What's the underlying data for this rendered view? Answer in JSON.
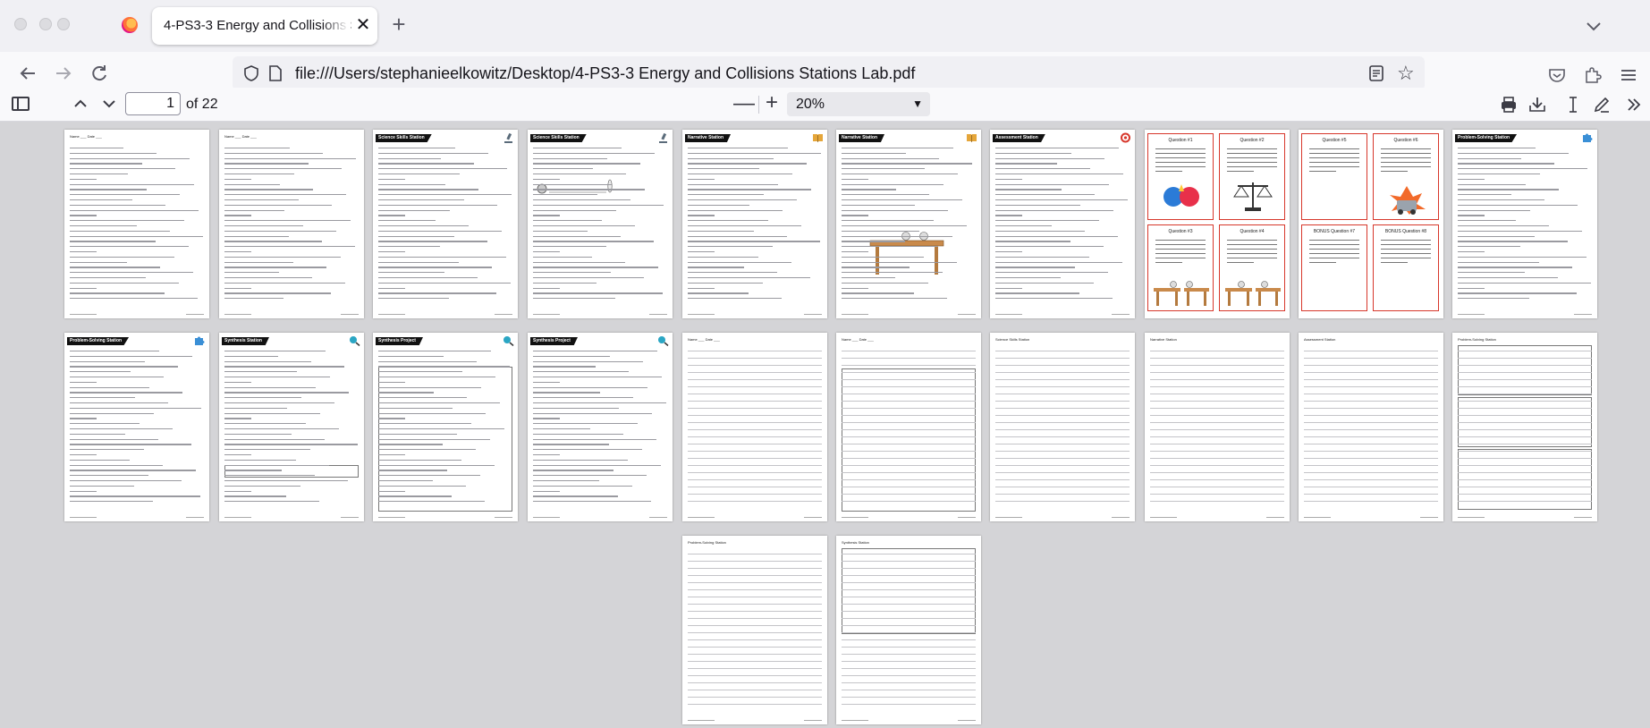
{
  "browser": {
    "tab_title": "4-PS3-3 Energy and Collisions Stations Lab.pdf",
    "tab_close_glyph": "✕",
    "new_tab_glyph": "+",
    "url": "file:///Users/stephanieelkowitz/Desktop/4-PS3-3 Energy and Collisions Stations Lab.pdf",
    "icons": [
      "firefox-logo",
      "back-arrow-icon",
      "forward-arrow-icon",
      "reload-icon",
      "shield-icon",
      "page-icon",
      "reader-view-icon",
      "bookmark-star-icon",
      "pocket-icon",
      "extensions-icon",
      "menu-icon",
      "tab-list-icon"
    ]
  },
  "pdf_toolbar": {
    "page_input": "1",
    "page_count": "of 22",
    "zoom_value": "20%",
    "zoom_out_glyph": "—",
    "zoom_in_glyph": "+",
    "icons": [
      "sidebar-toggle-icon",
      "page-up-icon",
      "page-down-icon",
      "print-icon",
      "download-icon",
      "text-cursor-icon",
      "draw-icon",
      "more-tools-icon"
    ]
  },
  "pages": [
    {
      "n": 1,
      "header": "Name ___ Date ___",
      "kind": "plain"
    },
    {
      "n": 2,
      "header": "Name ___ Date ___",
      "kind": "plain"
    },
    {
      "n": 3,
      "header": "Science Skills Station",
      "kind": "banner"
    },
    {
      "n": 4,
      "header": "Science Skills Station",
      "kind": "banner"
    },
    {
      "n": 5,
      "header": "Narrative Station",
      "kind": "banner"
    },
    {
      "n": 6,
      "header": "Narrative Station",
      "kind": "banner"
    },
    {
      "n": 7,
      "header": "Assessment Station",
      "kind": "banner"
    },
    {
      "n": 8,
      "header": "",
      "kind": "cards"
    },
    {
      "n": 9,
      "header": "",
      "kind": "cards"
    },
    {
      "n": 10,
      "header": "Problem-Solving Station",
      "kind": "banner"
    },
    {
      "n": 11,
      "header": "Problem-Solving Station",
      "kind": "banner"
    },
    {
      "n": 12,
      "header": "Synthesis Station",
      "kind": "banner"
    },
    {
      "n": 13,
      "header": "Synthesis Project",
      "kind": "banner"
    },
    {
      "n": 14,
      "header": "Synthesis Project",
      "kind": "banner"
    },
    {
      "n": 15,
      "header": "Name ___ Date ___",
      "kind": "plain"
    },
    {
      "n": 16,
      "header": "Name ___ Date ___",
      "kind": "plain"
    },
    {
      "n": 17,
      "header": "Science Skills Station",
      "kind": "sheet"
    },
    {
      "n": 18,
      "header": "Narrative Station",
      "kind": "sheet"
    },
    {
      "n": 19,
      "header": "Assessment Station",
      "kind": "sheet"
    },
    {
      "n": 20,
      "header": "Problem-Solving Station",
      "kind": "sheet"
    },
    {
      "n": 21,
      "header": "Problem-Solving Station",
      "kind": "sheet"
    },
    {
      "n": 22,
      "header": "Synthesis Station",
      "kind": "sheet"
    }
  ],
  "cards": {
    "q1": "Question #1",
    "q2": "Question #2",
    "q5": "Question #5",
    "q6": "Question #6",
    "q3": "Question #3",
    "q4": "Question #4",
    "b7": "BONUS Question #7",
    "b8": "BONUS Question #8"
  }
}
